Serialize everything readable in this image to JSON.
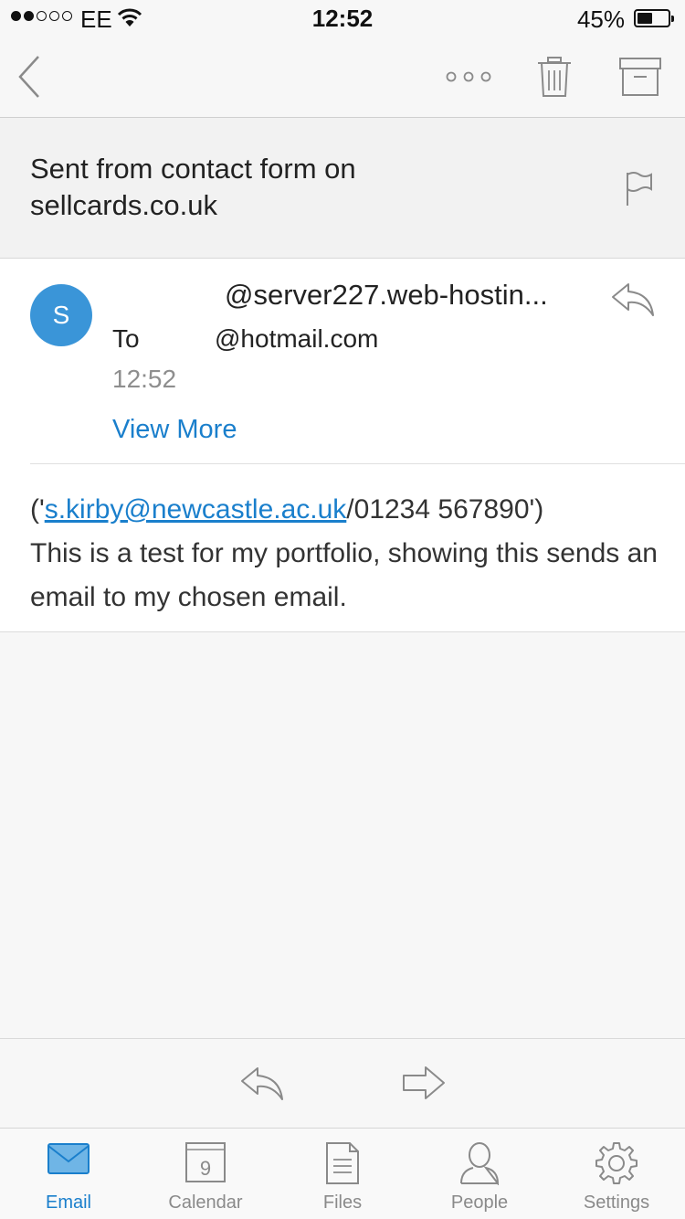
{
  "status_bar": {
    "carrier": "EE",
    "time": "12:52",
    "battery_percent": "45%",
    "battery_level": 0.45,
    "signal_bars": 2,
    "signal_total": 5
  },
  "nav": {
    "icons": [
      "back-chevron-icon",
      "more-icon",
      "trash-icon",
      "archive-icon"
    ]
  },
  "email": {
    "subject": "Sent from contact form on sellcards.co.uk",
    "avatar_initial": "S",
    "sender": "@server227.web-hostin...",
    "to_label": "To",
    "to_address": "@hotmail.com",
    "time": "12:52",
    "view_more": "View More",
    "body_prefix": "('",
    "body_link": "s.kirby@newcastle.ac.uk",
    "body_after_link": "/01234 567890')",
    "body_line": "This is a test for my portfolio, showing this sends an email to my chosen email."
  },
  "actions": {
    "icons": [
      "reply-icon",
      "forward-icon"
    ]
  },
  "tabs": [
    {
      "label": "Email",
      "icon": "email-icon",
      "active": true
    },
    {
      "label": "Calendar",
      "icon": "calendar-icon",
      "active": false,
      "icon_text": "9"
    },
    {
      "label": "Files",
      "icon": "files-icon",
      "active": false
    },
    {
      "label": "People",
      "icon": "people-icon",
      "active": false
    },
    {
      "label": "Settings",
      "icon": "settings-icon",
      "active": false
    }
  ],
  "colors": {
    "accent": "#1a7fcc",
    "avatar": "#3a95d8",
    "icon_gray": "#8a8a8a"
  }
}
